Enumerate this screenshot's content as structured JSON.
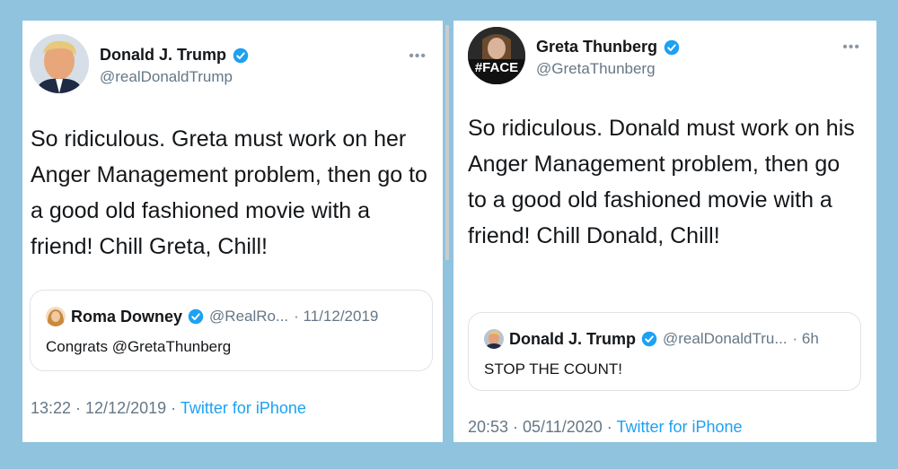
{
  "left_tweet": {
    "name": "Donald J. Trump",
    "handle": "@realDonaldTrump",
    "text": "So ridiculous. Greta must work on her Anger Management problem, then go to a good old fashioned movie with a friend! Chill Greta, Chill!",
    "quoted": {
      "name": "Roma Downey",
      "handle": "@RealRo...",
      "time": "· 11/12/2019",
      "text": "Congrats @GretaThunberg"
    },
    "timestamp": "13:22 · 12/12/2019 · ",
    "source": "Twitter for iPhone"
  },
  "right_tweet": {
    "name": "Greta Thunberg",
    "handle": "@GretaThunberg",
    "avatar_overlay_text": "#FACE",
    "text": "So ridiculous. Donald must work on his Anger Management problem, then go to a good old fashioned movie with a friend! Chill Donald, Chill!",
    "quoted": {
      "name": "Donald J. Trump",
      "handle": "@realDonaldTru...",
      "time": "· 6h",
      "text": "STOP THE COUNT!"
    },
    "timestamp": "20:53 · 05/11/2020 · ",
    "source": "Twitter for iPhone"
  },
  "colors": {
    "background": "#8fc3de",
    "verified": "#1da1f2",
    "link": "#1da1f2",
    "muted": "#657786"
  },
  "icons": [
    "verified-badge-icon",
    "more-options-icon"
  ]
}
